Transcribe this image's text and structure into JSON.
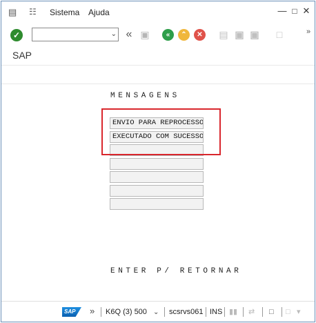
{
  "menubar": {
    "items": [
      {
        "label": "Sistema"
      },
      {
        "label": "Ajuda"
      }
    ]
  },
  "toolbar": {
    "command_value": "",
    "icons": [
      "check-icon",
      "dropdown-icon",
      "double-left-icon",
      "save-icon",
      "back-icon",
      "exit-icon",
      "cancel-icon",
      "print-icon",
      "find-icon",
      "find-next-icon",
      "new-session-icon",
      "more-icon"
    ]
  },
  "title": "SAP",
  "content": {
    "heading": "MENSAGENS",
    "messages": [
      "ENVIO PARA REPROCESSO",
      "EXECUTADO COM SUCESSO",
      "",
      "",
      "",
      "",
      ""
    ],
    "footer": "ENTER P/ RETORNAR"
  },
  "statusbar": {
    "logo": "SAP",
    "system": "K6Q (3) 500",
    "server": "scsrvs061",
    "mode": "INS"
  },
  "colors": {
    "ok_green": "#2e8b2e",
    "back_green": "#2e9e4a",
    "exit_yellow": "#f0b73c",
    "cancel_red": "#e0524a",
    "highlight_red": "#d9262c"
  }
}
